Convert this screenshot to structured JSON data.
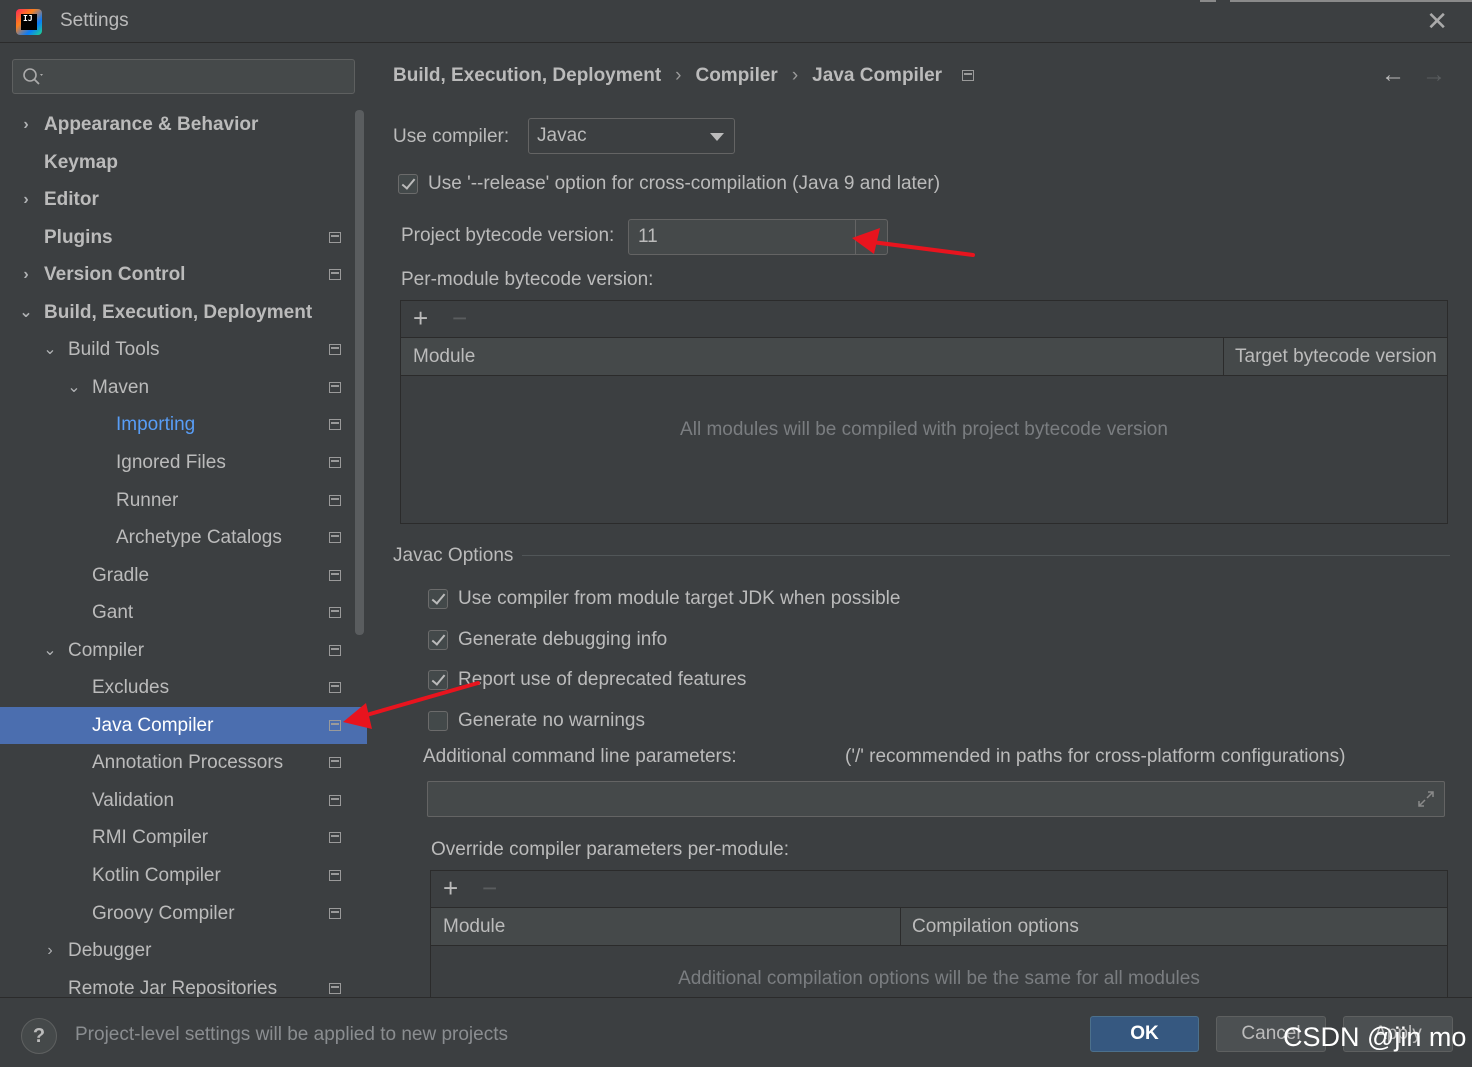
{
  "window": {
    "title": "Settings",
    "app_icon_text": "IJ",
    "close_icon": "close-icon"
  },
  "sidebar": {
    "search_placeholder": "",
    "items": [
      {
        "label": "Appearance & Behavior",
        "arrow": "›",
        "bold": true
      },
      {
        "label": "Keymap",
        "bold": true
      },
      {
        "label": "Editor",
        "arrow": "›",
        "bold": true
      },
      {
        "label": "Plugins",
        "bold": true,
        "project_icon": true
      },
      {
        "label": "Version Control",
        "arrow": "›",
        "bold": true,
        "project_icon": true
      },
      {
        "label": "Build, Execution, Deployment",
        "arrow": "⌄",
        "bold": true
      },
      {
        "label": "Build Tools",
        "arrow": "⌄",
        "project_icon": true
      },
      {
        "label": "Maven",
        "arrow": "⌄",
        "project_icon": true
      },
      {
        "label": "Importing",
        "link": true,
        "project_icon": true
      },
      {
        "label": "Ignored Files",
        "project_icon": true
      },
      {
        "label": "Runner",
        "project_icon": true
      },
      {
        "label": "Archetype Catalogs",
        "project_icon": true
      },
      {
        "label": "Gradle",
        "project_icon": true
      },
      {
        "label": "Gant",
        "project_icon": true
      },
      {
        "label": "Compiler",
        "arrow": "⌄",
        "project_icon": true
      },
      {
        "label": "Excludes",
        "project_icon": true
      },
      {
        "label": "Java Compiler",
        "selected": true,
        "project_icon": true
      },
      {
        "label": "Annotation Processors",
        "project_icon": true
      },
      {
        "label": "Validation",
        "project_icon": true
      },
      {
        "label": "RMI Compiler",
        "project_icon": true
      },
      {
        "label": "Kotlin Compiler",
        "project_icon": true
      },
      {
        "label": "Groovy Compiler",
        "project_icon": true
      },
      {
        "label": "Debugger",
        "arrow": "›"
      },
      {
        "label": "Remote Jar Repositories",
        "project_icon": true
      }
    ]
  },
  "breadcrumb": {
    "parts": [
      "Build, Execution, Deployment",
      "Compiler",
      "Java Compiler"
    ],
    "separator": "›"
  },
  "nav": {
    "back": "←",
    "forward": "→"
  },
  "compiler": {
    "use_compiler_label": "Use compiler:",
    "use_compiler_value": "Javac",
    "release_option_label": "Use '--release' option for cross-compilation (Java 9 and later)",
    "release_option_checked": true,
    "bytecode_label": "Project bytecode version:",
    "bytecode_value": "11",
    "per_module_label": "Per-module bytecode version:",
    "module_table": {
      "add": "+",
      "remove": "−",
      "columns": [
        "Module",
        "Target bytecode version"
      ],
      "empty_text": "All modules will be compiled with project bytecode version"
    }
  },
  "javac": {
    "section_title": "Javac Options",
    "options": [
      {
        "label": "Use compiler from module target JDK when possible",
        "checked": true
      },
      {
        "label": "Generate debugging info",
        "checked": true
      },
      {
        "label": "Report use of deprecated features",
        "checked": true
      },
      {
        "label": "Generate no warnings",
        "checked": false
      }
    ],
    "cmd_params_label": "Additional command line parameters:",
    "cmd_params_hint": "('/' recommended in paths for cross-platform configurations)",
    "cmd_params_value": "",
    "override_label": "Override compiler parameters per-module:",
    "override_table": {
      "add": "+",
      "remove": "−",
      "columns": [
        "Module",
        "Compilation options"
      ],
      "empty_text": "Additional compilation options will be the same for all modules"
    }
  },
  "footer": {
    "help": "?",
    "status": "Project-level settings will be applied to new projects",
    "ok": "OK",
    "cancel": "Cancel",
    "apply": "Apply",
    "watermark": "CSDN @jin mo"
  },
  "colors": {
    "background": "#3c3f41",
    "selection": "#4b6eaf",
    "link": "#589df6",
    "ok_button": "#365880",
    "annotation_arrow": "#e8141e"
  }
}
